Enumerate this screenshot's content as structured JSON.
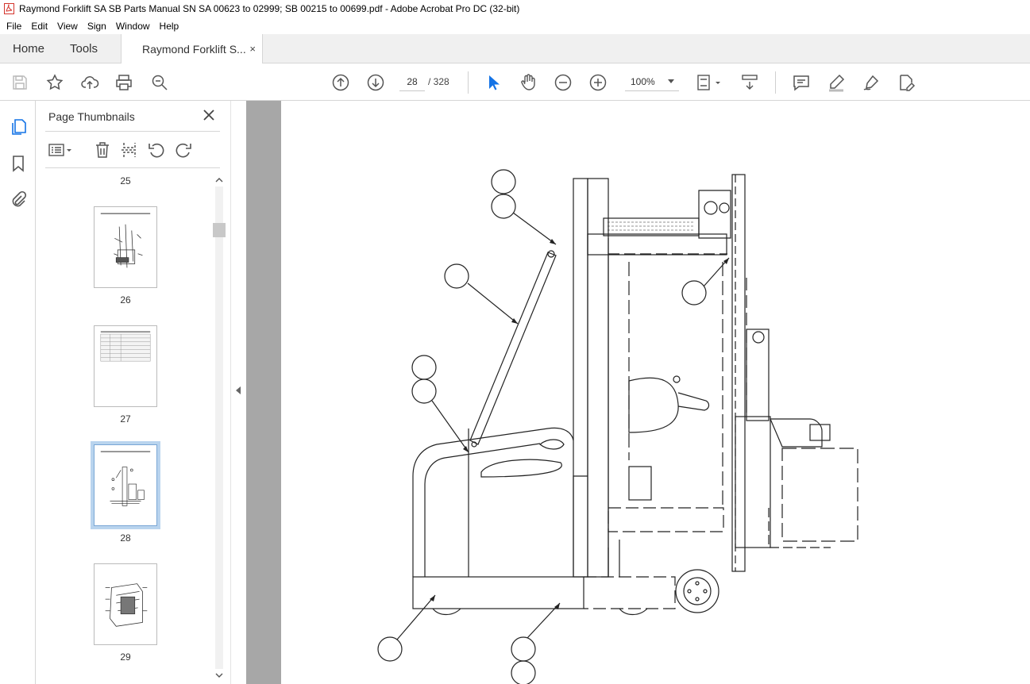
{
  "window": {
    "title": "Raymond Forklift SA SB Parts Manual SN SA 00623 to 02999; SB 00215 to 00699.pdf - Adobe Acrobat Pro DC (32-bit)",
    "icon": "acrobat-pdf-icon"
  },
  "menubar": {
    "items": [
      "File",
      "Edit",
      "View",
      "Sign",
      "Window",
      "Help"
    ]
  },
  "tabs": {
    "home": "Home",
    "tools": "Tools",
    "document": "Raymond Forklift S...",
    "close": "×"
  },
  "toolbar": {
    "icons": [
      "save-icon",
      "bookmark-star-icon",
      "upload-cloud-icon",
      "print-icon",
      "zoom-find-icon",
      "page-up-icon",
      "page-down-icon",
      "select-pointer-icon",
      "hand-pan-icon",
      "zoom-out-icon",
      "zoom-in-icon",
      "page-fit-icon",
      "scroll-mode-icon",
      "comment-icon",
      "highlight-pen-icon",
      "sign-pen-icon",
      "edit-pdf-icon"
    ],
    "current_page": "28",
    "page_total": "/ 328",
    "zoom": "100%"
  },
  "left_rail": {
    "icons": [
      "page-thumbnails-icon",
      "bookmarks-icon",
      "attachments-icon"
    ]
  },
  "thumbnail_panel": {
    "title": "Page Thumbnails",
    "pages": [
      {
        "label": "25"
      },
      {
        "label": "26"
      },
      {
        "label": "27"
      },
      {
        "label": "28",
        "selected": true
      },
      {
        "label": "29"
      }
    ]
  },
  "document": {
    "current_page": 28,
    "content": "forklift-parts-diagram"
  },
  "colors": {
    "accent": "#1473e6",
    "selection": "#b9d4ee",
    "viewer_bg": "#a7a7a7",
    "acrobat_red": "#d4342c"
  }
}
